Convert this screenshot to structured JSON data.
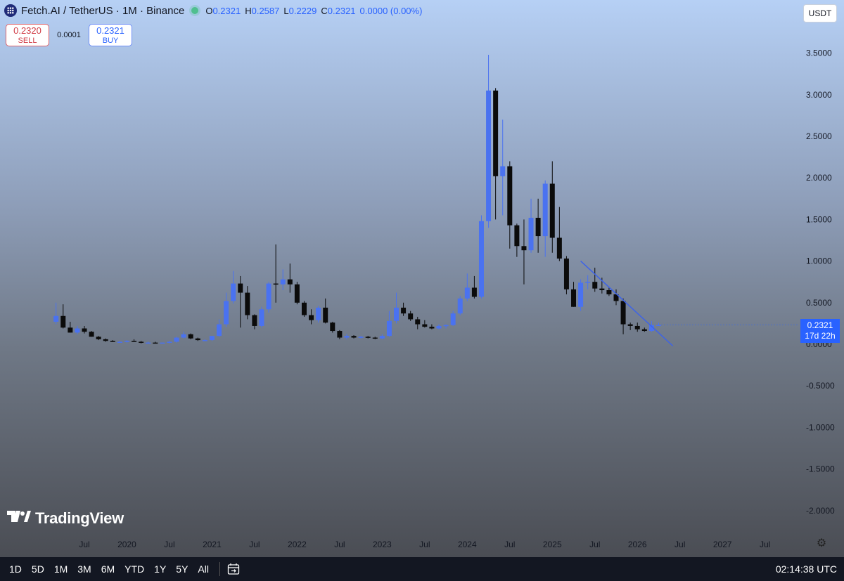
{
  "header": {
    "symbol": "Fetch.AI / TetherUS · 1M · Binance",
    "ohlc": {
      "o_label": "O",
      "o": "0.2321",
      "h_label": "H",
      "h": "0.2587",
      "l_label": "L",
      "l": "0.2229",
      "c_label": "C",
      "c": "0.2321",
      "change": "0.0000 (0.00%)"
    }
  },
  "trade": {
    "sell_price": "0.2320",
    "sell_label": "SELL",
    "spread": "0.0001",
    "buy_price": "0.2321",
    "buy_label": "BUY"
  },
  "currency_button": "USDT",
  "price_tag": {
    "price": "0.2321",
    "countdown": "17d 22h"
  },
  "watermark": "TradingView",
  "bottom_bar": {
    "ranges": [
      "1D",
      "5D",
      "1M",
      "3M",
      "6M",
      "YTD",
      "1Y",
      "5Y",
      "All"
    ],
    "clock": "02:14:38 UTC"
  },
  "colors": {
    "up": "#4a72f0",
    "down": "#0b0b0b",
    "trend_line": "#3d63e8"
  },
  "icons": [
    "fetch-ai-logo-icon",
    "status-dot-icon",
    "tradingview-logo-icon",
    "settings-gear-icon",
    "date-range-calendar-icon"
  ],
  "chart_data": {
    "type": "candlestick",
    "ylim": [
      -2.2,
      3.8
    ],
    "y_ticks": [
      "3.5000",
      "3.0000",
      "2.5000",
      "2.0000",
      "1.5000",
      "1.0000",
      "0.5000",
      "0.0000",
      "-0.5000",
      "-1.0000",
      "-1.5000",
      "-2.0000"
    ],
    "y_tick_values": [
      3.5,
      3.0,
      2.5,
      2.0,
      1.5,
      1.0,
      0.5,
      0.0,
      -0.5,
      -1.0,
      -1.5,
      -2.0
    ],
    "x_ticks": [
      {
        "label": "Jul",
        "date": "2019-07"
      },
      {
        "label": "2020",
        "date": "2020-01"
      },
      {
        "label": "Jul",
        "date": "2020-07"
      },
      {
        "label": "2021",
        "date": "2021-01"
      },
      {
        "label": "Jul",
        "date": "2021-07"
      },
      {
        "label": "2022",
        "date": "2022-01"
      },
      {
        "label": "Jul",
        "date": "2022-07"
      },
      {
        "label": "2023",
        "date": "2023-01"
      },
      {
        "label": "Jul",
        "date": "2023-07"
      },
      {
        "label": "2024",
        "date": "2024-01"
      },
      {
        "label": "Jul",
        "date": "2024-07"
      },
      {
        "label": "2025",
        "date": "2025-01"
      },
      {
        "label": "Jul",
        "date": "2025-07"
      },
      {
        "label": "2026",
        "date": "2026-01"
      },
      {
        "label": "Jul",
        "date": "2026-07"
      },
      {
        "label": "2027",
        "date": "2027-01"
      },
      {
        "label": "Jul",
        "date": "2027-07"
      }
    ],
    "candles": [
      {
        "date": "2019-03",
        "o": 0.27,
        "h": 0.5,
        "l": 0.24,
        "c": 0.34
      },
      {
        "date": "2019-04",
        "o": 0.34,
        "h": 0.48,
        "l": 0.19,
        "c": 0.2
      },
      {
        "date": "2019-05",
        "o": 0.2,
        "h": 0.27,
        "l": 0.14,
        "c": 0.14
      },
      {
        "date": "2019-06",
        "o": 0.14,
        "h": 0.22,
        "l": 0.12,
        "c": 0.19
      },
      {
        "date": "2019-07",
        "o": 0.19,
        "h": 0.22,
        "l": 0.13,
        "c": 0.15
      },
      {
        "date": "2019-08",
        "o": 0.15,
        "h": 0.16,
        "l": 0.09,
        "c": 0.09
      },
      {
        "date": "2019-09",
        "o": 0.09,
        "h": 0.1,
        "l": 0.05,
        "c": 0.06
      },
      {
        "date": "2019-10",
        "o": 0.06,
        "h": 0.07,
        "l": 0.03,
        "c": 0.04
      },
      {
        "date": "2019-11",
        "o": 0.04,
        "h": 0.05,
        "l": 0.03,
        "c": 0.03
      },
      {
        "date": "2019-12",
        "o": 0.03,
        "h": 0.04,
        "l": 0.02,
        "c": 0.03
      },
      {
        "date": "2020-01",
        "o": 0.03,
        "h": 0.05,
        "l": 0.02,
        "c": 0.04
      },
      {
        "date": "2020-02",
        "o": 0.04,
        "h": 0.06,
        "l": 0.03,
        "c": 0.03
      },
      {
        "date": "2020-03",
        "o": 0.03,
        "h": 0.04,
        "l": 0.01,
        "c": 0.02
      },
      {
        "date": "2020-04",
        "o": 0.02,
        "h": 0.03,
        "l": 0.01,
        "c": 0.02
      },
      {
        "date": "2020-05",
        "o": 0.02,
        "h": 0.03,
        "l": 0.01,
        "c": 0.01
      },
      {
        "date": "2020-06",
        "o": 0.01,
        "h": 0.02,
        "l": 0.01,
        "c": 0.02
      },
      {
        "date": "2020-07",
        "o": 0.02,
        "h": 0.04,
        "l": 0.01,
        "c": 0.03
      },
      {
        "date": "2020-08",
        "o": 0.03,
        "h": 0.09,
        "l": 0.02,
        "c": 0.08
      },
      {
        "date": "2020-09",
        "o": 0.08,
        "h": 0.15,
        "l": 0.07,
        "c": 0.12
      },
      {
        "date": "2020-10",
        "o": 0.12,
        "h": 0.13,
        "l": 0.06,
        "c": 0.07
      },
      {
        "date": "2020-11",
        "o": 0.07,
        "h": 0.08,
        "l": 0.04,
        "c": 0.05
      },
      {
        "date": "2020-12",
        "o": 0.05,
        "h": 0.06,
        "l": 0.04,
        "c": 0.05
      },
      {
        "date": "2021-01",
        "o": 0.05,
        "h": 0.1,
        "l": 0.04,
        "c": 0.1
      },
      {
        "date": "2021-02",
        "o": 0.1,
        "h": 0.3,
        "l": 0.09,
        "c": 0.24
      },
      {
        "date": "2021-03",
        "o": 0.24,
        "h": 0.62,
        "l": 0.21,
        "c": 0.52
      },
      {
        "date": "2021-04",
        "o": 0.52,
        "h": 0.88,
        "l": 0.49,
        "c": 0.73
      },
      {
        "date": "2021-05",
        "o": 0.73,
        "h": 0.82,
        "l": 0.2,
        "c": 0.62
      },
      {
        "date": "2021-06",
        "o": 0.62,
        "h": 0.7,
        "l": 0.3,
        "c": 0.35
      },
      {
        "date": "2021-07",
        "o": 0.35,
        "h": 0.36,
        "l": 0.18,
        "c": 0.22
      },
      {
        "date": "2021-08",
        "o": 0.22,
        "h": 0.45,
        "l": 0.2,
        "c": 0.42
      },
      {
        "date": "2021-09",
        "o": 0.42,
        "h": 0.75,
        "l": 0.38,
        "c": 0.73
      },
      {
        "date": "2021-10",
        "o": 0.73,
        "h": 1.2,
        "l": 0.5,
        "c": 0.72
      },
      {
        "date": "2021-11",
        "o": 0.72,
        "h": 0.9,
        "l": 0.65,
        "c": 0.78
      },
      {
        "date": "2021-12",
        "o": 0.78,
        "h": 0.97,
        "l": 0.62,
        "c": 0.72
      },
      {
        "date": "2022-01",
        "o": 0.72,
        "h": 0.75,
        "l": 0.48,
        "c": 0.5
      },
      {
        "date": "2022-02",
        "o": 0.5,
        "h": 0.52,
        "l": 0.33,
        "c": 0.35
      },
      {
        "date": "2022-03",
        "o": 0.35,
        "h": 0.42,
        "l": 0.24,
        "c": 0.29
      },
      {
        "date": "2022-04",
        "o": 0.29,
        "h": 0.46,
        "l": 0.26,
        "c": 0.44
      },
      {
        "date": "2022-05",
        "o": 0.44,
        "h": 0.55,
        "l": 0.25,
        "c": 0.26
      },
      {
        "date": "2022-06",
        "o": 0.26,
        "h": 0.27,
        "l": 0.14,
        "c": 0.16
      },
      {
        "date": "2022-07",
        "o": 0.16,
        "h": 0.17,
        "l": 0.06,
        "c": 0.08
      },
      {
        "date": "2022-08",
        "o": 0.08,
        "h": 0.12,
        "l": 0.06,
        "c": 0.1
      },
      {
        "date": "2022-09",
        "o": 0.1,
        "h": 0.11,
        "l": 0.07,
        "c": 0.08
      },
      {
        "date": "2022-10",
        "o": 0.08,
        "h": 0.1,
        "l": 0.07,
        "c": 0.09
      },
      {
        "date": "2022-11",
        "o": 0.09,
        "h": 0.1,
        "l": 0.07,
        "c": 0.08
      },
      {
        "date": "2022-12",
        "o": 0.08,
        "h": 0.09,
        "l": 0.06,
        "c": 0.07
      },
      {
        "date": "2023-01",
        "o": 0.07,
        "h": 0.12,
        "l": 0.06,
        "c": 0.1
      },
      {
        "date": "2023-02",
        "o": 0.1,
        "h": 0.4,
        "l": 0.09,
        "c": 0.28
      },
      {
        "date": "2023-03",
        "o": 0.28,
        "h": 0.62,
        "l": 0.25,
        "c": 0.44
      },
      {
        "date": "2023-04",
        "o": 0.44,
        "h": 0.5,
        "l": 0.34,
        "c": 0.37
      },
      {
        "date": "2023-05",
        "o": 0.37,
        "h": 0.4,
        "l": 0.28,
        "c": 0.3
      },
      {
        "date": "2023-06",
        "o": 0.3,
        "h": 0.33,
        "l": 0.18,
        "c": 0.24
      },
      {
        "date": "2023-07",
        "o": 0.24,
        "h": 0.29,
        "l": 0.2,
        "c": 0.21
      },
      {
        "date": "2023-08",
        "o": 0.21,
        "h": 0.24,
        "l": 0.18,
        "c": 0.19
      },
      {
        "date": "2023-09",
        "o": 0.19,
        "h": 0.24,
        "l": 0.18,
        "c": 0.22
      },
      {
        "date": "2023-10",
        "o": 0.22,
        "h": 0.24,
        "l": 0.19,
        "c": 0.23
      },
      {
        "date": "2023-11",
        "o": 0.23,
        "h": 0.4,
        "l": 0.22,
        "c": 0.37
      },
      {
        "date": "2023-12",
        "o": 0.37,
        "h": 0.58,
        "l": 0.35,
        "c": 0.55
      },
      {
        "date": "2024-01",
        "o": 0.55,
        "h": 0.85,
        "l": 0.52,
        "c": 0.68
      },
      {
        "date": "2024-02",
        "o": 0.68,
        "h": 0.82,
        "l": 0.55,
        "c": 0.57
      },
      {
        "date": "2024-03",
        "o": 0.57,
        "h": 1.55,
        "l": 0.55,
        "c": 1.48
      },
      {
        "date": "2024-04",
        "o": 1.48,
        "h": 3.48,
        "l": 1.4,
        "c": 3.05
      },
      {
        "date": "2024-05",
        "o": 3.05,
        "h": 3.08,
        "l": 1.5,
        "c": 2.02
      },
      {
        "date": "2024-06",
        "o": 2.02,
        "h": 2.7,
        "l": 1.55,
        "c": 2.14
      },
      {
        "date": "2024-07",
        "o": 2.14,
        "h": 2.2,
        "l": 1.15,
        "c": 1.43
      },
      {
        "date": "2024-08",
        "o": 1.43,
        "h": 1.45,
        "l": 1.05,
        "c": 1.18
      },
      {
        "date": "2024-09",
        "o": 1.18,
        "h": 1.5,
        "l": 0.72,
        "c": 1.13
      },
      {
        "date": "2024-10",
        "o": 1.13,
        "h": 1.75,
        "l": 1.1,
        "c": 1.52
      },
      {
        "date": "2024-11",
        "o": 1.52,
        "h": 1.75,
        "l": 1.1,
        "c": 1.3
      },
      {
        "date": "2024-12",
        "o": 1.3,
        "h": 1.97,
        "l": 1.05,
        "c": 1.93
      },
      {
        "date": "2025-01",
        "o": 1.93,
        "h": 2.2,
        "l": 1.1,
        "c": 1.28
      },
      {
        "date": "2025-02",
        "o": 1.28,
        "h": 1.65,
        "l": 1.0,
        "c": 1.03
      },
      {
        "date": "2025-03",
        "o": 1.03,
        "h": 1.06,
        "l": 0.6,
        "c": 0.66
      },
      {
        "date": "2025-04",
        "o": 0.66,
        "h": 0.75,
        "l": 0.45,
        "c": 0.45
      },
      {
        "date": "2025-05",
        "o": 0.45,
        "h": 0.78,
        "l": 0.4,
        "c": 0.74
      },
      {
        "date": "2025-06",
        "o": 0.74,
        "h": 0.83,
        "l": 0.66,
        "c": 0.75
      },
      {
        "date": "2025-07",
        "o": 0.75,
        "h": 0.92,
        "l": 0.63,
        "c": 0.67
      },
      {
        "date": "2025-08",
        "o": 0.67,
        "h": 0.8,
        "l": 0.61,
        "c": 0.65
      },
      {
        "date": "2025-09",
        "o": 0.65,
        "h": 0.68,
        "l": 0.58,
        "c": 0.6
      },
      {
        "date": "2025-10",
        "o": 0.6,
        "h": 0.66,
        "l": 0.47,
        "c": 0.52
      },
      {
        "date": "2025-11",
        "o": 0.52,
        "h": 0.55,
        "l": 0.12,
        "c": 0.24
      },
      {
        "date": "2025-12",
        "o": 0.24,
        "h": 0.26,
        "l": 0.17,
        "c": 0.22
      },
      {
        "date": "2026-01",
        "o": 0.22,
        "h": 0.26,
        "l": 0.15,
        "c": 0.18
      },
      {
        "date": "2026-02",
        "o": 0.18,
        "h": 0.2,
        "l": 0.15,
        "c": 0.16
      },
      {
        "date": "2026-03",
        "o": 0.16,
        "h": 0.28,
        "l": 0.15,
        "c": 0.23
      },
      {
        "date": "2026-04",
        "o": 0.2321,
        "h": 0.2587,
        "l": 0.2229,
        "c": 0.2321
      }
    ],
    "trend_line": {
      "start": {
        "date": "2025-05",
        "value": 1.0
      },
      "end": {
        "date": "2026-06",
        "value": -0.02
      }
    },
    "grid": false
  }
}
